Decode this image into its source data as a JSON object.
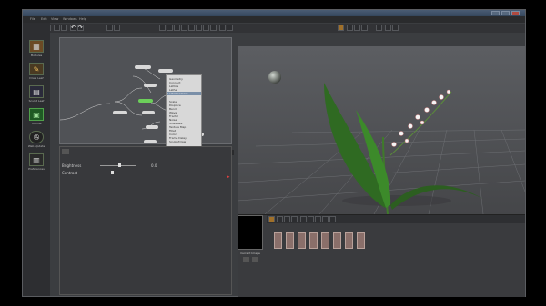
{
  "window": {
    "title": "",
    "accent": "#3e8f3a"
  },
  "menubar": {
    "items": [
      "File",
      "Edit",
      "View",
      "Windows",
      "Help"
    ]
  },
  "left_toolbar": {
    "items": [
      {
        "label": "Modules",
        "icon": "modules-icon"
      },
      {
        "label": "Draw Leaf",
        "icon": "pencil-icon"
      },
      {
        "label": "Sculpt Leaf",
        "icon": "clapper-icon"
      },
      {
        "label": "Tutorial",
        "icon": "tutorial-icon"
      },
      {
        "label": "Web Update",
        "icon": "film-reel-icon"
      },
      {
        "label": "Preferences",
        "icon": "preferences-icon"
      }
    ]
  },
  "context_menu": {
    "items": [
      "Geometry",
      "Connect",
      "Lattice",
      "Lathe",
      "Leaf Ornament",
      "",
      "Scale",
      "Displace",
      "Bend",
      "Wave",
      "Fractal",
      "Noise",
      "Sinewave",
      "Texture Map",
      "Fillet",
      "Color",
      "Frame Delay",
      "Sculpt/Draw"
    ],
    "status": "Brightness Contrast (id: 0)"
  },
  "properties": {
    "sliders": [
      {
        "label": "Brightness",
        "value": "0.0"
      },
      {
        "label": "Contrast",
        "value": ""
      }
    ]
  },
  "bottom_panel": {
    "current_image_label": "Current Image"
  }
}
